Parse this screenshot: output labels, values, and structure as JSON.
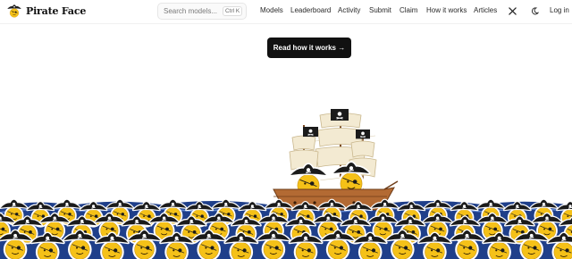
{
  "brand": {
    "name": "Pirate Face",
    "logo_icon": "pirate-face-logo-icon"
  },
  "search": {
    "placeholder": "Search models...",
    "shortcut": "Ctrl K"
  },
  "nav": {
    "items": [
      "Models",
      "Leaderboard",
      "Activity",
      "Submit",
      "Claim",
      "How it works",
      "Articles"
    ],
    "x_icon": "x-logo-icon",
    "theme_icon": "moon-icon",
    "login": "Log in"
  },
  "hero": {
    "cta_label": "Read how it works →"
  },
  "colors": {
    "accent": "#111111",
    "sea_blue": "#1f3f8a",
    "face_yellow": "#f5c118",
    "hat_black": "#1b1b1b",
    "sail": "#f3ead2",
    "hull": "#b36a33"
  }
}
